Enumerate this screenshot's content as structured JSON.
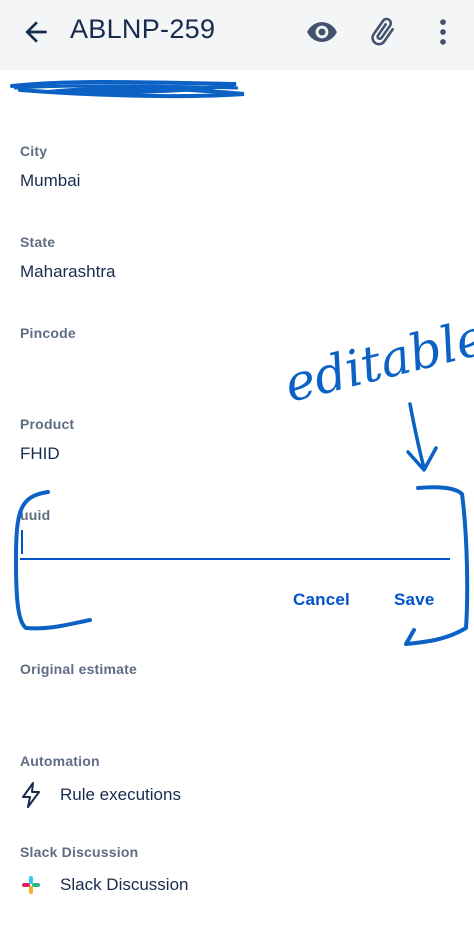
{
  "header": {
    "title": "ABLNP-259",
    "icons": [
      "back-arrow-icon",
      "eye-icon",
      "paperclip-icon",
      "more-vertical-icon"
    ]
  },
  "fields": {
    "city": {
      "label": "City",
      "value": "Mumbai"
    },
    "state": {
      "label": "State",
      "value": "Maharashtra"
    },
    "pincode": {
      "label": "Pincode",
      "value": ""
    },
    "product": {
      "label": "Product",
      "value": "FHID"
    },
    "uuid": {
      "label": "uuid",
      "value": ""
    },
    "original_estimate": {
      "label": "Original estimate",
      "value": ""
    },
    "automation": {
      "label": "Automation",
      "link": "Rule executions",
      "icon": "lightning-icon"
    },
    "slack": {
      "label": "Slack Discussion",
      "link": "Slack Discussion",
      "icon": "slack-icon"
    }
  },
  "actions": {
    "cancel": "Cancel",
    "save": "Save"
  },
  "annotation": {
    "text": "editable",
    "color": "#0b62c4"
  },
  "colors": {
    "accent": "#0052cc",
    "header_bg": "#f4f5f7",
    "ink": "#172b4d",
    "label": "#5e6c84"
  }
}
